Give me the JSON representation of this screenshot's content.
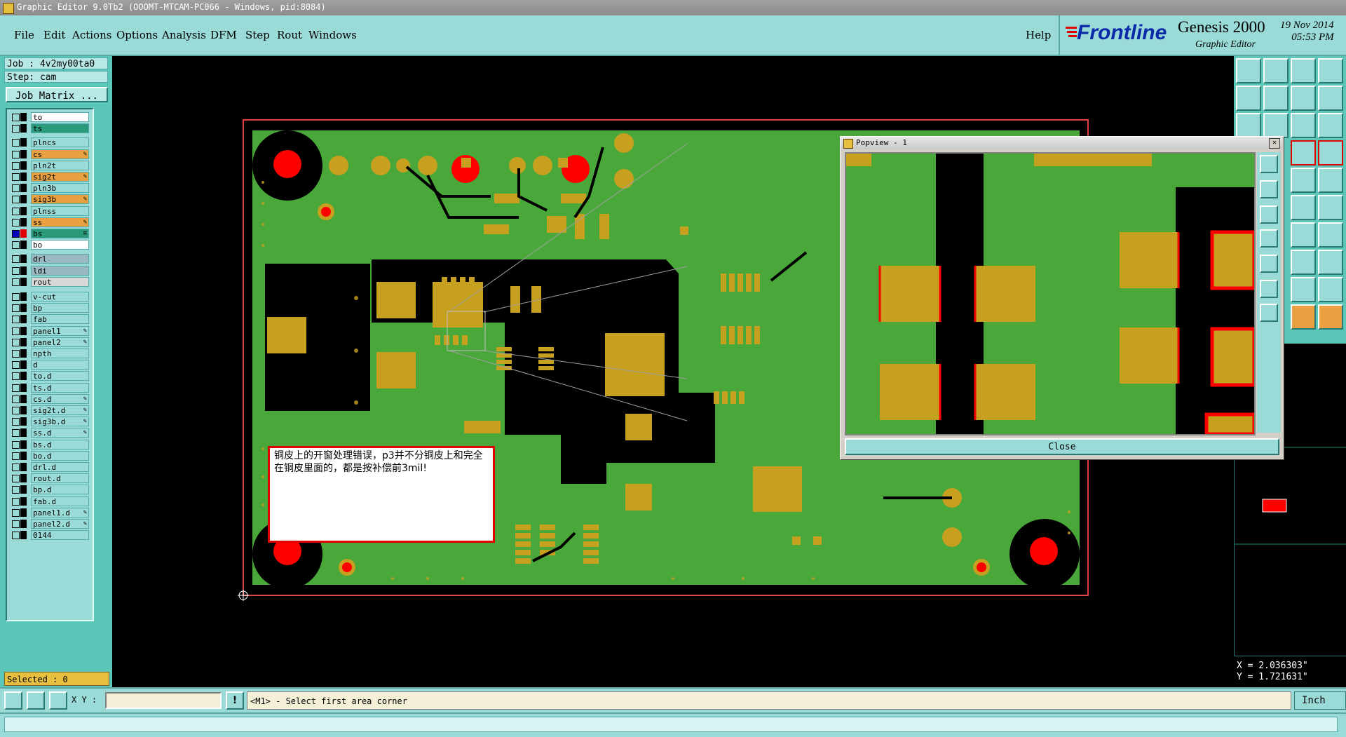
{
  "window": {
    "title": "Graphic Editor 9.0Tb2 (OOOMT-MTCAM-PC066 - Windows, pid:8084)"
  },
  "menu": {
    "items": [
      "File",
      "Edit",
      "Actions",
      "Options",
      "Analysis",
      "DFM",
      "Step",
      "Rout",
      "Windows"
    ],
    "help": "Help"
  },
  "brand": {
    "logo": "Frontline",
    "product": "Genesis 2000",
    "subtitle": "Graphic Editor",
    "date": "19 Nov 2014",
    "time": "05:53 PM"
  },
  "job": {
    "job_label": "Job : 4v2my00ta0",
    "step_label": "Step: cam",
    "matrix_button": "Job Matrix ..."
  },
  "layers": [
    {
      "name": "to",
      "color": "#ffffff",
      "mark": ""
    },
    {
      "name": "ts",
      "color": "#2a9a7a",
      "mark": ""
    },
    {
      "name": "plncs",
      "color": "#9adbd8",
      "mark": ""
    },
    {
      "name": "cs",
      "color": "#e8a040",
      "mark": "✎"
    },
    {
      "name": "pln2t",
      "color": "#9adbd8",
      "mark": ""
    },
    {
      "name": "sig2t",
      "color": "#e8a040",
      "mark": "✎"
    },
    {
      "name": "pln3b",
      "color": "#9adbd8",
      "mark": ""
    },
    {
      "name": "sig3b",
      "color": "#e8a040",
      "mark": "✎"
    },
    {
      "name": "plnss",
      "color": "#9adbd8",
      "mark": ""
    },
    {
      "name": "ss",
      "color": "#e8a040",
      "mark": "✎"
    },
    {
      "name": "bs",
      "color": "#2a9a7a",
      "mark": "≡"
    },
    {
      "name": "bo",
      "color": "#ffffff",
      "mark": ""
    },
    {
      "name": "drl",
      "color": "#9ab8c0",
      "mark": ""
    },
    {
      "name": "ldi",
      "color": "#9ab8c0",
      "mark": ""
    },
    {
      "name": "rout",
      "color": "#d8d8d8",
      "mark": ""
    },
    {
      "name": "v-cut",
      "color": "#9adbd8",
      "mark": ""
    },
    {
      "name": "bp",
      "color": "#9adbd8",
      "mark": ""
    },
    {
      "name": "fab",
      "color": "#9adbd8",
      "mark": ""
    },
    {
      "name": "panel1",
      "color": "#9adbd8",
      "mark": "✎"
    },
    {
      "name": "panel2",
      "color": "#9adbd8",
      "mark": "✎"
    },
    {
      "name": "npth",
      "color": "#9adbd8",
      "mark": ""
    },
    {
      "name": "d",
      "color": "#9adbd8",
      "mark": ""
    },
    {
      "name": "to.d",
      "color": "#9adbd8",
      "mark": ""
    },
    {
      "name": "ts.d",
      "color": "#9adbd8",
      "mark": ""
    },
    {
      "name": "cs.d",
      "color": "#9adbd8",
      "mark": "✎"
    },
    {
      "name": "sig2t.d",
      "color": "#9adbd8",
      "mark": "✎"
    },
    {
      "name": "sig3b.d",
      "color": "#9adbd8",
      "mark": "✎"
    },
    {
      "name": "ss.d",
      "color": "#9adbd8",
      "mark": "✎"
    },
    {
      "name": "bs.d",
      "color": "#9adbd8",
      "mark": ""
    },
    {
      "name": "bo.d",
      "color": "#9adbd8",
      "mark": ""
    },
    {
      "name": "drl.d",
      "color": "#9adbd8",
      "mark": ""
    },
    {
      "name": "rout.d",
      "color": "#9adbd8",
      "mark": ""
    },
    {
      "name": "bp.d",
      "color": "#9adbd8",
      "mark": ""
    },
    {
      "name": "fab.d",
      "color": "#9adbd8",
      "mark": ""
    },
    {
      "name": "panel1.d",
      "color": "#9adbd8",
      "mark": "✎"
    },
    {
      "name": "panel2.d",
      "color": "#9adbd8",
      "mark": "✎"
    },
    {
      "name": "0144",
      "color": "#9adbd8",
      "mark": ""
    }
  ],
  "selected_label": "Selected : 0",
  "note_text": "铜皮上的开窗处理错误，p3并不分铜皮上和完全在铜皮里面的，都是按补偿前3mil!",
  "popview": {
    "title": "Popview - 1",
    "close_label": "Close"
  },
  "coords": {
    "x": "X = 2.036303\"",
    "y": "Y = 1.721631\""
  },
  "bottom": {
    "xy_label": "X Y :",
    "xy_value": "",
    "status_message": "<M1> - Select first area corner",
    "unit": "Inch"
  },
  "colors": {
    "board": "#4aa83a",
    "copper": "#c8a020",
    "drill": "#ff0000",
    "panel_bg": "#5cc6b8",
    "menu_bg": "#9adbd8"
  }
}
